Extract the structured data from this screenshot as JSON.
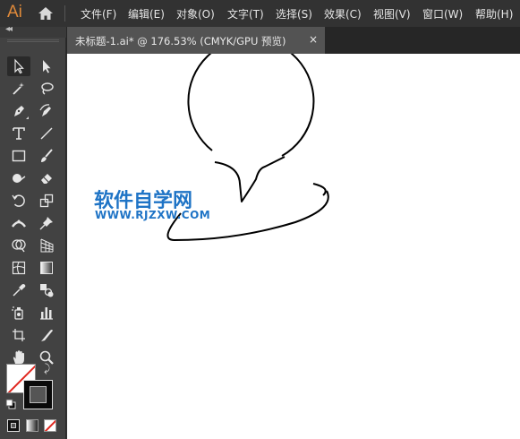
{
  "app": {
    "logo": "Ai",
    "accent": "#e08a3a"
  },
  "menu": {
    "items": [
      {
        "label": "文件(F)"
      },
      {
        "label": "编辑(E)"
      },
      {
        "label": "对象(O)"
      },
      {
        "label": "文字(T)"
      },
      {
        "label": "选择(S)"
      },
      {
        "label": "效果(C)"
      },
      {
        "label": "视图(V)"
      },
      {
        "label": "窗口(W)"
      },
      {
        "label": "帮助(H)"
      }
    ]
  },
  "document_tab": {
    "title": "未标题-1.ai* @ 176.53% (CMYK/GPU 预览)",
    "close": "×"
  },
  "toolbar": {
    "collapse": "◂◂",
    "tools": [
      {
        "name": "selection-tool",
        "icon": "arrow-icon"
      },
      {
        "name": "direct-selection-tool",
        "icon": "white-arrow-icon"
      },
      {
        "name": "magic-wand-tool",
        "icon": "magic-wand-icon"
      },
      {
        "name": "lasso-tool",
        "icon": "lasso-icon"
      },
      {
        "name": "pen-tool",
        "icon": "pen-icon"
      },
      {
        "name": "curvature-tool",
        "icon": "curvature-pen-icon"
      },
      {
        "name": "type-tool",
        "icon": "type-icon"
      },
      {
        "name": "line-tool",
        "icon": "line-segment-icon"
      },
      {
        "name": "rectangle-tool",
        "icon": "rectangle-icon"
      },
      {
        "name": "paintbrush-tool",
        "icon": "paintbrush-icon"
      },
      {
        "name": "shaper-tool",
        "icon": "shaper-icon"
      },
      {
        "name": "eraser-tool",
        "icon": "eraser-icon"
      },
      {
        "name": "rotate-tool",
        "icon": "rotate-icon"
      },
      {
        "name": "scale-tool",
        "icon": "scale-icon"
      },
      {
        "name": "width-tool",
        "icon": "width-icon"
      },
      {
        "name": "puppet-warp-tool",
        "icon": "pin-icon"
      },
      {
        "name": "shape-builder-tool",
        "icon": "shape-builder-icon"
      },
      {
        "name": "perspective-grid-tool",
        "icon": "perspective-grid-icon"
      },
      {
        "name": "mesh-tool",
        "icon": "mesh-icon"
      },
      {
        "name": "gradient-tool",
        "icon": "gradient-icon"
      },
      {
        "name": "eyedropper-tool",
        "icon": "eyedropper-icon"
      },
      {
        "name": "blend-tool",
        "icon": "blend-icon"
      },
      {
        "name": "symbol-sprayer-tool",
        "icon": "symbol-sprayer-icon"
      },
      {
        "name": "graph-tool",
        "icon": "bar-graph-icon"
      },
      {
        "name": "artboard-tool",
        "icon": "artboard-icon"
      },
      {
        "name": "slice-tool",
        "icon": "slice-icon"
      },
      {
        "name": "hand-tool",
        "icon": "hand-icon"
      },
      {
        "name": "zoom-tool",
        "icon": "zoom-icon"
      }
    ],
    "fill_color": "#ffffff",
    "stroke_color": "#000000",
    "swap": "⤸"
  },
  "canvas": {
    "background": "#ffffff",
    "watermark": {
      "title": "软件自学网",
      "url": "WWW.RJZXW.COM",
      "color": "#1f74c6"
    }
  }
}
